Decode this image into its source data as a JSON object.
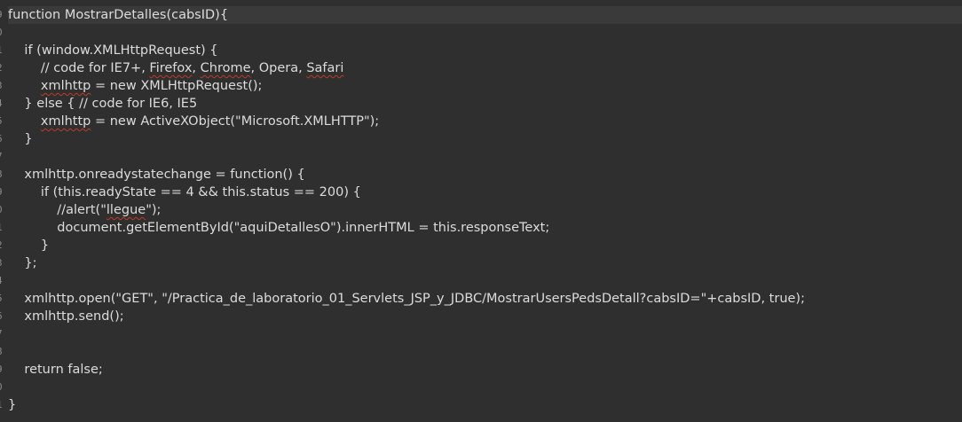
{
  "editor": {
    "line_numbers": [
      "9",
      "0",
      "1",
      "2",
      "3",
      "4",
      "5",
      "6",
      "7",
      "8",
      "9",
      "0",
      "1",
      "2",
      "3",
      "4",
      "5",
      "6",
      "7",
      "8",
      "9",
      "0",
      "1"
    ],
    "lines": [
      "function MostrarDetalles(cabsID){",
      "",
      "    if (window.XMLHttpRequest) {",
      "        // code for IE7+, ",
      "        ",
      "    } else { // code for IE6, IE5",
      "        ",
      "    }",
      "",
      "    xmlhttp.onreadystatechange = function() {",
      "        if (this.readyState == 4 && this.status == 200) {",
      "            //alert(\"",
      "            document.getElementById(\"aquiDetallesO\").innerHTML = this.responseText;",
      "        }",
      "    };",
      "",
      "    xmlhttp.open(\"GET\", \"/Practica_de_laboratorio_01_Servlets_JSP_y_JDBC/MostrarUsersPedsDetall?cabsID=\"+cabsID, true);",
      "    xmlhttp.send();",
      "",
      "",
      "    return false;",
      "",
      "}"
    ],
    "seg": {
      "firefox": "Firefox",
      "comma1": ", ",
      "chrome": "Chrome",
      "opera": ", Opera, ",
      "safari": "Safari",
      "xmlhttp": "xmlhttp",
      "new_xhr": " = new XMLHttpRequest();",
      "new_ax": " = new ActiveXObject(\"Microsoft.XMLHTTP\");",
      "llegue": "llegue",
      "alert_end": "\");"
    }
  }
}
